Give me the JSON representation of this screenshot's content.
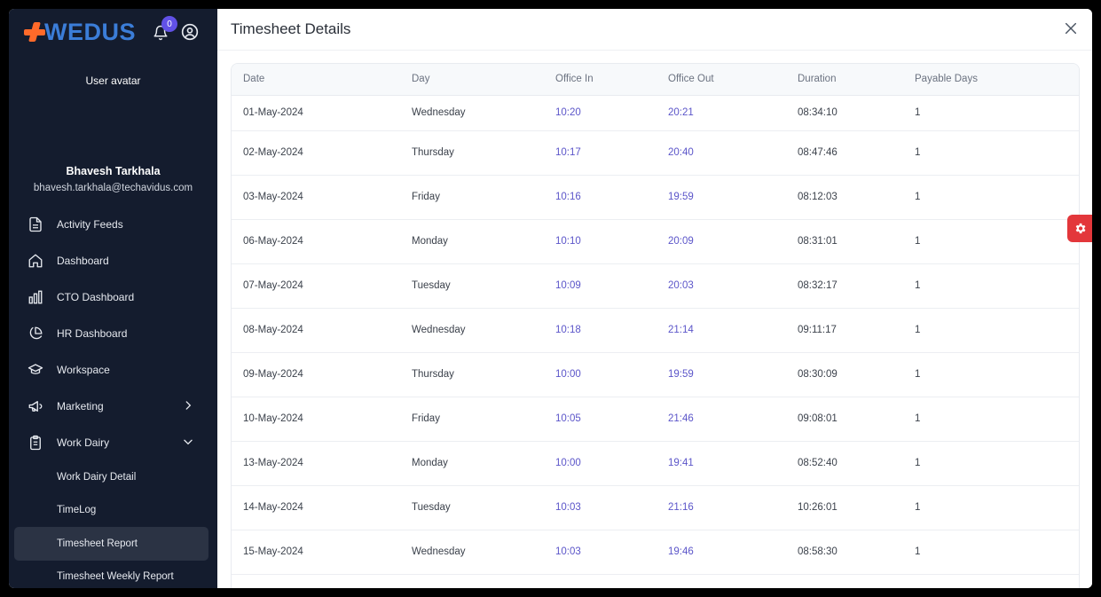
{
  "sidebar": {
    "logo_text": "WEDUS",
    "notification_count": "0",
    "avatar_alt": "User avatar",
    "user_name": "Bhavesh Tarkhala",
    "user_email": "bhavesh.tarkhala@techavidus.com",
    "items": [
      {
        "label": "Activity Feeds",
        "icon": "document-icon"
      },
      {
        "label": "Dashboard",
        "icon": "home-icon"
      },
      {
        "label": "CTO Dashboard",
        "icon": "bar-chart-icon"
      },
      {
        "label": "HR Dashboard",
        "icon": "pie-chart-icon"
      },
      {
        "label": "Workspace",
        "icon": "graduation-cap-icon"
      },
      {
        "label": "Marketing",
        "icon": "megaphone-icon"
      },
      {
        "label": "Work Dairy",
        "icon": "clipboard-icon"
      }
    ],
    "sub_items": [
      {
        "label": "Work Dairy Detail"
      },
      {
        "label": "TimeLog"
      },
      {
        "label": "Timesheet Report"
      },
      {
        "label": "Timesheet Weekly Report"
      }
    ]
  },
  "main": {
    "title": "Timesheet Details",
    "columns": [
      "Date",
      "Day",
      "Office In",
      "Office Out",
      "Duration",
      "Payable Days"
    ],
    "rows": [
      [
        "01-May-2024",
        "Wednesday",
        "10:20",
        "20:21",
        "08:34:10",
        "1"
      ],
      [
        "02-May-2024",
        "Thursday",
        "10:17",
        "20:40",
        "08:47:46",
        "1"
      ],
      [
        "03-May-2024",
        "Friday",
        "10:16",
        "19:59",
        "08:12:03",
        "1"
      ],
      [
        "06-May-2024",
        "Monday",
        "10:10",
        "20:09",
        "08:31:01",
        "1"
      ],
      [
        "07-May-2024",
        "Tuesday",
        "10:09",
        "20:03",
        "08:32:17",
        "1"
      ],
      [
        "08-May-2024",
        "Wednesday",
        "10:18",
        "21:14",
        "09:11:17",
        "1"
      ],
      [
        "09-May-2024",
        "Thursday",
        "10:00",
        "19:59",
        "08:30:09",
        "1"
      ],
      [
        "10-May-2024",
        "Friday",
        "10:05",
        "21:46",
        "09:08:01",
        "1"
      ],
      [
        "13-May-2024",
        "Monday",
        "10:00",
        "19:41",
        "08:52:40",
        "1"
      ],
      [
        "14-May-2024",
        "Tuesday",
        "10:03",
        "21:16",
        "10:26:01",
        "1"
      ],
      [
        "15-May-2024",
        "Wednesday",
        "10:03",
        "19:46",
        "08:58:30",
        "1"
      ],
      [
        "",
        "",
        "",
        "",
        "",
        ""
      ]
    ]
  },
  "colors": {
    "sidebar_bg": "#141c2e",
    "accent_orange": "#ff6a2a",
    "logo_blue": "#3b7dd8",
    "time_link": "#5b55c9",
    "settings_red": "#e3373b"
  }
}
